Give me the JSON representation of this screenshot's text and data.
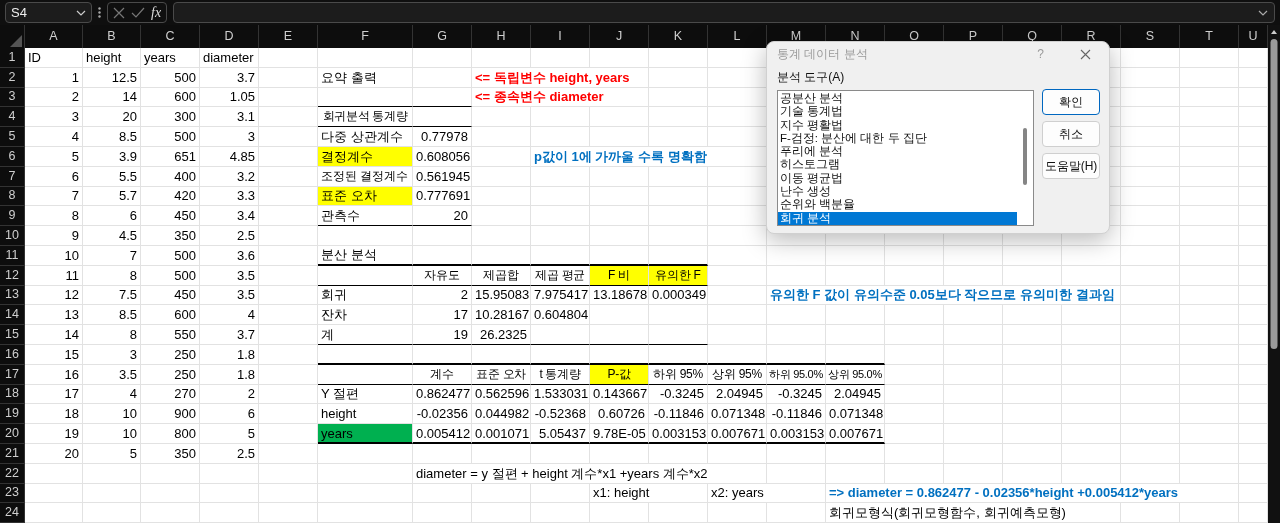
{
  "name_box": {
    "value": "S4"
  },
  "formula_bar": {
    "function_label": "fx"
  },
  "columns": [
    "A",
    "B",
    "C",
    "D",
    "E",
    "F",
    "G",
    "H",
    "I",
    "J",
    "K",
    "L",
    "M",
    "N",
    "O",
    "P",
    "Q",
    "R",
    "S",
    "T",
    "U"
  ],
  "rows": [
    {
      "number": "1",
      "cells": {
        "A": {
          "text": "ID",
          "kind": "text"
        },
        "B": {
          "text": "height",
          "kind": "text"
        },
        "C": {
          "text": "years",
          "kind": "text"
        },
        "D": {
          "text": "diameter",
          "kind": "text"
        }
      }
    },
    {
      "number": "2",
      "cells": {
        "A": {
          "text": "1",
          "kind": "number"
        },
        "B": {
          "text": "12.5",
          "kind": "number"
        },
        "C": {
          "text": "500",
          "kind": "number"
        },
        "D": {
          "text": "3.7",
          "kind": "number"
        },
        "F": {
          "text": "요약 출력",
          "kind": "text"
        },
        "H": {
          "text": "<= 독립변수 height, years",
          "kind": "note",
          "color": "#ff0000"
        }
      }
    },
    {
      "number": "3",
      "cells": {
        "A": {
          "text": "2",
          "kind": "number"
        },
        "B": {
          "text": "14",
          "kind": "number"
        },
        "C": {
          "text": "600",
          "kind": "number"
        },
        "D": {
          "text": "1.05",
          "kind": "number"
        },
        "H": {
          "text": "<= 종속변수 diameter",
          "kind": "note",
          "color": "#ff0000"
        }
      }
    },
    {
      "number": "4",
      "cells": {
        "A": {
          "text": "3",
          "kind": "number"
        },
        "B": {
          "text": "20",
          "kind": "number"
        },
        "C": {
          "text": "300",
          "kind": "number"
        },
        "D": {
          "text": "3.1",
          "kind": "number"
        },
        "F": {
          "text": "회귀분석 통계량",
          "kind": "heading"
        }
      }
    },
    {
      "number": "5",
      "cells": {
        "A": {
          "text": "4",
          "kind": "number"
        },
        "B": {
          "text": "8.5",
          "kind": "number"
        },
        "C": {
          "text": "500",
          "kind": "number"
        },
        "D": {
          "text": "3",
          "kind": "number"
        },
        "F": {
          "text": "다중 상관계수",
          "kind": "text"
        },
        "G": {
          "text": "0.77978",
          "kind": "number"
        }
      }
    },
    {
      "number": "6",
      "cells": {
        "A": {
          "text": "5",
          "kind": "number"
        },
        "B": {
          "text": "3.9",
          "kind": "number"
        },
        "C": {
          "text": "651",
          "kind": "number"
        },
        "D": {
          "text": "4.85",
          "kind": "number"
        },
        "F": {
          "text": "결정계수",
          "kind": "text",
          "color": "#ffff00"
        },
        "G": {
          "text": "0.608056",
          "kind": "number"
        },
        "I": {
          "text": "p값이 1에 가까울 수록 명확함",
          "kind": "note",
          "color": "#0070c0"
        }
      }
    },
    {
      "number": "7",
      "cells": {
        "A": {
          "text": "6",
          "kind": "number"
        },
        "B": {
          "text": "5.5",
          "kind": "number"
        },
        "C": {
          "text": "400",
          "kind": "number"
        },
        "D": {
          "text": "3.2",
          "kind": "number"
        },
        "F": {
          "text": "조정된 결정계수",
          "kind": "text"
        },
        "G": {
          "text": "0.561945",
          "kind": "number"
        }
      }
    },
    {
      "number": "8",
      "cells": {
        "A": {
          "text": "7",
          "kind": "number"
        },
        "B": {
          "text": "5.7",
          "kind": "number"
        },
        "C": {
          "text": "420",
          "kind": "number"
        },
        "D": {
          "text": "3.3",
          "kind": "number"
        },
        "F": {
          "text": "표준 오차",
          "kind": "text",
          "color": "#ffff00"
        },
        "G": {
          "text": "0.777691",
          "kind": "number"
        }
      }
    },
    {
      "number": "9",
      "cells": {
        "A": {
          "text": "8",
          "kind": "number"
        },
        "B": {
          "text": "6",
          "kind": "number"
        },
        "C": {
          "text": "450",
          "kind": "number"
        },
        "D": {
          "text": "3.4",
          "kind": "number"
        },
        "F": {
          "text": "관측수",
          "kind": "text"
        },
        "G": {
          "text": "20",
          "kind": "number"
        }
      }
    },
    {
      "number": "10",
      "cells": {
        "A": {
          "text": "9",
          "kind": "number"
        },
        "B": {
          "text": "4.5",
          "kind": "number"
        },
        "C": {
          "text": "350",
          "kind": "number"
        },
        "D": {
          "text": "2.5",
          "kind": "number"
        }
      }
    },
    {
      "number": "11",
      "cells": {
        "A": {
          "text": "10",
          "kind": "number"
        },
        "B": {
          "text": "7",
          "kind": "number"
        },
        "C": {
          "text": "500",
          "kind": "number"
        },
        "D": {
          "text": "3.6",
          "kind": "number"
        },
        "F": {
          "text": "분산 분석",
          "kind": "text"
        }
      }
    },
    {
      "number": "12",
      "cells": {
        "A": {
          "text": "11",
          "kind": "number"
        },
        "B": {
          "text": "8",
          "kind": "number"
        },
        "C": {
          "text": "500",
          "kind": "number"
        },
        "D": {
          "text": "3.5",
          "kind": "number"
        },
        "G": {
          "text": "자유도",
          "kind": "heading"
        },
        "H": {
          "text": "제곱합",
          "kind": "heading"
        },
        "I": {
          "text": "제곱 평균",
          "kind": "heading"
        },
        "J": {
          "text": "F 비",
          "kind": "heading",
          "color": "#ffff00"
        },
        "K": {
          "text": "유의한 F",
          "kind": "heading",
          "color": "#ffff00"
        }
      }
    },
    {
      "number": "13",
      "cells": {
        "A": {
          "text": "12",
          "kind": "number"
        },
        "B": {
          "text": "7.5",
          "kind": "number"
        },
        "C": {
          "text": "450",
          "kind": "number"
        },
        "D": {
          "text": "3.5",
          "kind": "number"
        },
        "F": {
          "text": "회귀",
          "kind": "text"
        },
        "G": {
          "text": "2",
          "kind": "number"
        },
        "H": {
          "text": "15.95083",
          "kind": "number"
        },
        "I": {
          "text": "7.975417",
          "kind": "number"
        },
        "J": {
          "text": "13.18678",
          "kind": "number"
        },
        "K": {
          "text": "0.000349",
          "kind": "number"
        },
        "M": {
          "text": "유의한 F 값이 유의수준 0.05보다 작으므로 유의미한 결과임",
          "kind": "note",
          "color": "#0070c0"
        }
      }
    },
    {
      "number": "14",
      "cells": {
        "A": {
          "text": "13",
          "kind": "number"
        },
        "B": {
          "text": "8.5",
          "kind": "number"
        },
        "C": {
          "text": "600",
          "kind": "number"
        },
        "D": {
          "text": "4",
          "kind": "number"
        },
        "F": {
          "text": "잔차",
          "kind": "text"
        },
        "G": {
          "text": "17",
          "kind": "number"
        },
        "H": {
          "text": "10.28167",
          "kind": "number"
        },
        "I": {
          "text": "0.604804",
          "kind": "number"
        }
      }
    },
    {
      "number": "15",
      "cells": {
        "A": {
          "text": "14",
          "kind": "number"
        },
        "B": {
          "text": "8",
          "kind": "number"
        },
        "C": {
          "text": "550",
          "kind": "number"
        },
        "D": {
          "text": "3.7",
          "kind": "number"
        },
        "F": {
          "text": "계",
          "kind": "text"
        },
        "G": {
          "text": "19",
          "kind": "number"
        },
        "H": {
          "text": "26.2325",
          "kind": "number"
        }
      }
    },
    {
      "number": "16",
      "cells": {
        "A": {
          "text": "15",
          "kind": "number"
        },
        "B": {
          "text": "3",
          "kind": "number"
        },
        "C": {
          "text": "250",
          "kind": "number"
        },
        "D": {
          "text": "1.8",
          "kind": "number"
        }
      }
    },
    {
      "number": "17",
      "cells": {
        "A": {
          "text": "16",
          "kind": "number"
        },
        "B": {
          "text": "3.5",
          "kind": "number"
        },
        "C": {
          "text": "250",
          "kind": "number"
        },
        "D": {
          "text": "1.8",
          "kind": "number"
        },
        "G": {
          "text": "계수",
          "kind": "heading"
        },
        "H": {
          "text": "표준 오차",
          "kind": "heading"
        },
        "I": {
          "text": "t 통계량",
          "kind": "heading"
        },
        "J": {
          "text": "P-값",
          "kind": "heading",
          "color": "#ffff00"
        },
        "K": {
          "text": "하위 95%",
          "kind": "heading"
        },
        "L": {
          "text": "상위 95%",
          "kind": "heading"
        },
        "M": {
          "text": "하위 95.0%",
          "kind": "heading"
        },
        "N": {
          "text": "상위 95.0%",
          "kind": "heading"
        }
      }
    },
    {
      "number": "18",
      "cells": {
        "A": {
          "text": "17",
          "kind": "number"
        },
        "B": {
          "text": "4",
          "kind": "number"
        },
        "C": {
          "text": "270",
          "kind": "number"
        },
        "D": {
          "text": "2",
          "kind": "number"
        },
        "F": {
          "text": "Y 절편",
          "kind": "text"
        },
        "G": {
          "text": "0.862477",
          "kind": "number"
        },
        "H": {
          "text": "0.562596",
          "kind": "number"
        },
        "I": {
          "text": "1.533031",
          "kind": "number"
        },
        "J": {
          "text": "0.143667",
          "kind": "number"
        },
        "K": {
          "text": "-0.3245",
          "kind": "number"
        },
        "L": {
          "text": "2.04945",
          "kind": "number"
        },
        "M": {
          "text": "-0.3245",
          "kind": "number"
        },
        "N": {
          "text": "2.04945",
          "kind": "number"
        }
      }
    },
    {
      "number": "19",
      "cells": {
        "A": {
          "text": "18",
          "kind": "number"
        },
        "B": {
          "text": "10",
          "kind": "number"
        },
        "C": {
          "text": "900",
          "kind": "number"
        },
        "D": {
          "text": "6",
          "kind": "number"
        },
        "F": {
          "text": "height",
          "kind": "text"
        },
        "G": {
          "text": "-0.02356",
          "kind": "number"
        },
        "H": {
          "text": "0.044982",
          "kind": "number"
        },
        "I": {
          "text": "-0.52368",
          "kind": "number"
        },
        "J": {
          "text": "0.60726",
          "kind": "number"
        },
        "K": {
          "text": "-0.11846",
          "kind": "number"
        },
        "L": {
          "text": "0.071348",
          "kind": "number"
        },
        "M": {
          "text": "-0.11846",
          "kind": "number"
        },
        "N": {
          "text": "0.071348",
          "kind": "number"
        }
      }
    },
    {
      "number": "20",
      "cells": {
        "A": {
          "text": "19",
          "kind": "number"
        },
        "B": {
          "text": "10",
          "kind": "number"
        },
        "C": {
          "text": "800",
          "kind": "number"
        },
        "D": {
          "text": "5",
          "kind": "number"
        },
        "F": {
          "text": "years",
          "kind": "text",
          "color": "#00b050"
        },
        "G": {
          "text": "0.005412",
          "kind": "number"
        },
        "H": {
          "text": "0.001071",
          "kind": "number"
        },
        "I": {
          "text": "5.05437",
          "kind": "number"
        },
        "J": {
          "text": "9.78E-05",
          "kind": "number"
        },
        "K": {
          "text": "0.003153",
          "kind": "number"
        },
        "L": {
          "text": "0.007671",
          "kind": "number"
        },
        "M": {
          "text": "0.003153",
          "kind": "number"
        },
        "N": {
          "text": "0.007671",
          "kind": "number"
        }
      }
    },
    {
      "number": "21",
      "cells": {
        "A": {
          "text": "20",
          "kind": "number"
        },
        "B": {
          "text": "5",
          "kind": "number"
        },
        "C": {
          "text": "350",
          "kind": "number"
        },
        "D": {
          "text": "2.5",
          "kind": "number"
        }
      }
    },
    {
      "number": "22",
      "cells": {
        "G": {
          "text": "diameter = y 절편 + height 계수*x1 +years 계수*x2",
          "kind": "text"
        }
      }
    },
    {
      "number": "23",
      "cells": {
        "J": {
          "text": "x1: height",
          "kind": "text"
        },
        "L": {
          "text": "x2: years",
          "kind": "text"
        },
        "N": {
          "text": "=> diameter = 0.862477 - 0.02356*height +0.005412*years",
          "kind": "note",
          "color": "#0070c0"
        }
      }
    },
    {
      "number": "24",
      "cells": {
        "N": {
          "text": "회귀모형식(회귀모형함수, 회귀예측모형)",
          "kind": "text"
        }
      }
    }
  ],
  "dialog": {
    "title": "통계 데이터 분석",
    "help": "?",
    "list_label": "분석 도구(A)",
    "tools": [
      {
        "label": "공분산 분석",
        "selected": false
      },
      {
        "label": "기술 통계법",
        "selected": false
      },
      {
        "label": "지수 평활법",
        "selected": false
      },
      {
        "label": "F-검정: 분산에 대한 두 집단",
        "selected": false
      },
      {
        "label": "푸리에 분석",
        "selected": false
      },
      {
        "label": "히스토그램",
        "selected": false
      },
      {
        "label": "이동 평균법",
        "selected": false
      },
      {
        "label": "난수 생성",
        "selected": false
      },
      {
        "label": "순위와 백분율",
        "selected": false
      },
      {
        "label": "회귀 분석",
        "selected": true
      }
    ],
    "buttons": [
      {
        "label": "확인",
        "kind": "default"
      },
      {
        "label": "취소",
        "kind": "normal"
      },
      {
        "label": "도움말(H)",
        "kind": "normal"
      }
    ]
  }
}
